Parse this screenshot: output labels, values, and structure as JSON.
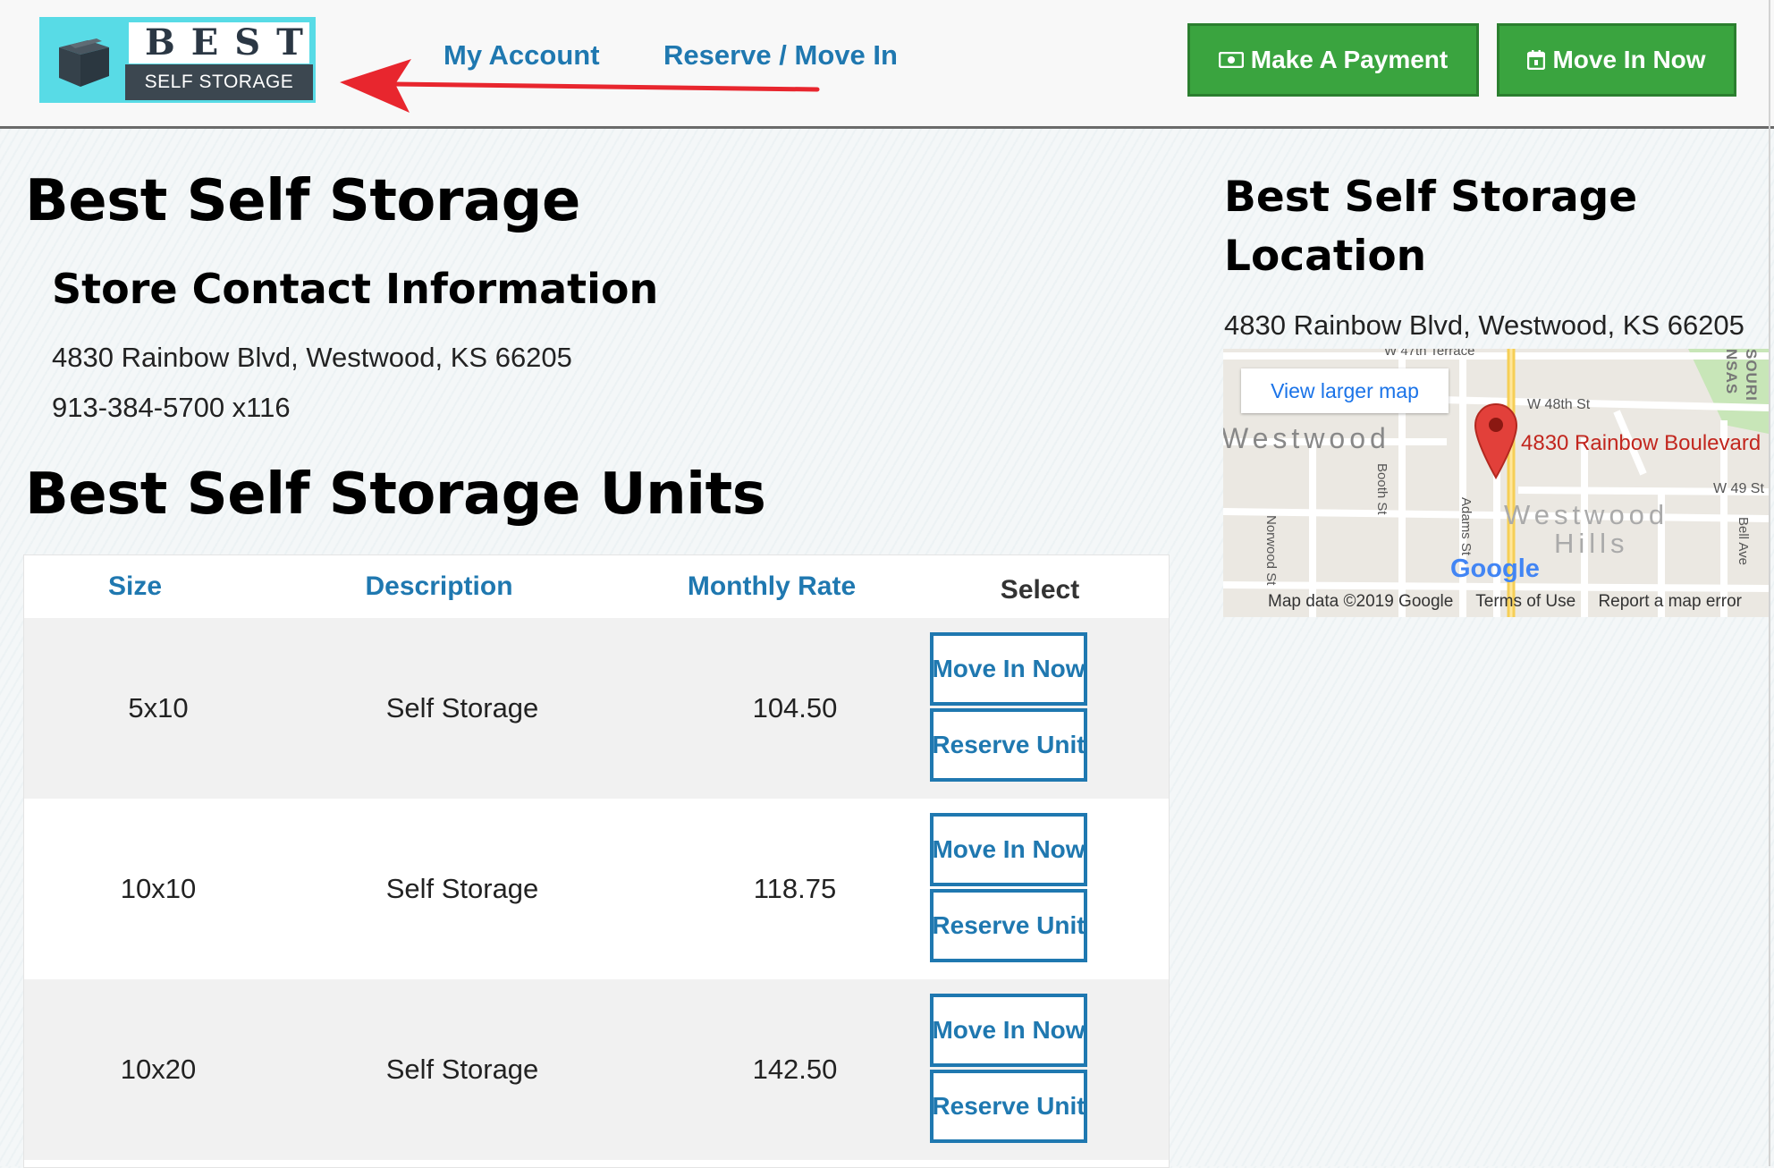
{
  "header": {
    "logo": {
      "word": "BEST",
      "tagline": "SELF STORAGE"
    },
    "nav": [
      {
        "label": "My Account"
      },
      {
        "label": "Reserve / Move In"
      }
    ],
    "cta": [
      {
        "icon": "money-icon",
        "label": "Make A Payment",
        "color": "#3aa43f"
      },
      {
        "icon": "calendar-icon",
        "label": "Move In Now",
        "color": "#3aa43f"
      }
    ]
  },
  "main": {
    "title": "Best Self Storage",
    "contact_heading": "Store Contact Information",
    "address": "4830 Rainbow Blvd, Westwood, KS 66205",
    "phone": "913-384-5700 x116",
    "units_heading": "Best Self Storage Units"
  },
  "units_table": {
    "headers": [
      "Size",
      "Description",
      "Monthly Rate",
      "Select"
    ],
    "rows": [
      {
        "size": "5x10",
        "description": "Self Storage",
        "rate": "104.50",
        "move_in_label": "Move In Now",
        "reserve_label": "Reserve Unit"
      },
      {
        "size": "10x10",
        "description": "Self Storage",
        "rate": "118.75",
        "move_in_label": "Move In Now",
        "reserve_label": "Reserve Unit"
      },
      {
        "size": "10x20",
        "description": "Self Storage",
        "rate": "142.50",
        "move_in_label": "Move In Now",
        "reserve_label": "Reserve Unit"
      }
    ]
  },
  "location": {
    "heading": "Best Self Storage Location",
    "address": "4830 Rainbow Blvd, Westwood, KS 66205",
    "map": {
      "view_larger": "View larger map",
      "marker_label": "4830 Rainbow Boulevard",
      "streets": [
        "W 47th Terrace",
        "W 48th St",
        "W 49 St",
        "Booth St",
        "Adams St",
        "Norwood St",
        "Bell Ave",
        "SOURI",
        "NSAS"
      ],
      "area_labels": [
        "Westwood",
        "Westwood",
        "Hills"
      ],
      "brand": "Google",
      "footer": [
        "Map data ©2019 Google",
        "Terms of Use",
        "Report a map error"
      ]
    }
  },
  "colors": {
    "link": "#1f78b0",
    "cta_green": "#3aa43f",
    "annotation_arrow": "#e8262e"
  }
}
